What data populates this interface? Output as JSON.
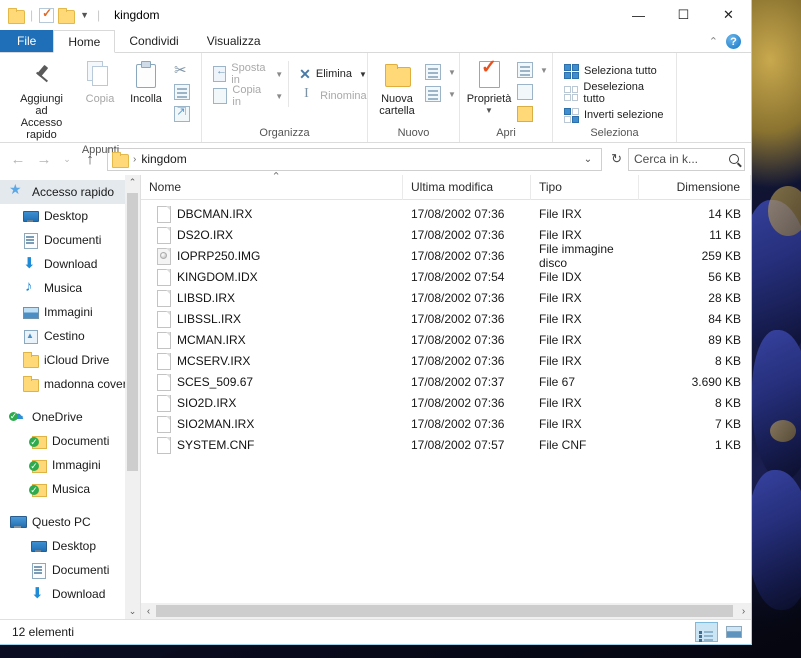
{
  "window": {
    "title": "kingdom",
    "quick_access": [
      "folder-icon",
      "properties-icon",
      "new-folder-icon"
    ],
    "controls": {
      "minimize": "—",
      "maximize": "☐",
      "close": "✕"
    }
  },
  "tabs": [
    {
      "label": "File",
      "kind": "file"
    },
    {
      "label": "Home",
      "kind": "active"
    },
    {
      "label": "Condividi",
      "kind": "normal"
    },
    {
      "label": "Visualizza",
      "kind": "normal"
    }
  ],
  "ribbon": {
    "collapse_caret": "⌃",
    "help": "?",
    "groups": [
      {
        "title": "Appunti",
        "big": [
          {
            "label": "Aggiungi ad\nAccesso rapido",
            "icon": "pin-icon",
            "disabled": false
          },
          {
            "label": "Copia",
            "icon": "copy-icon",
            "disabled": true
          },
          {
            "label": "Incolla",
            "icon": "paste-icon",
            "disabled": false
          }
        ],
        "small": [
          {
            "label": "",
            "icon": "scissors-icon"
          },
          {
            "label": "",
            "icon": "copy-path-icon"
          },
          {
            "label": "",
            "icon": "paste-shortcut-icon"
          }
        ]
      },
      {
        "title": "Organizza",
        "commands": [
          {
            "label": "Sposta in",
            "icon": "move-to-icon",
            "caret": true,
            "disabled": true
          },
          {
            "label": "Copia in",
            "icon": "copy-to-icon",
            "caret": true,
            "disabled": true
          },
          {
            "label": "Elimina",
            "icon": "delete-icon",
            "caret": true,
            "disabled": false
          },
          {
            "label": "Rinomina",
            "icon": "rename-icon",
            "caret": false,
            "disabled": true
          }
        ]
      },
      {
        "title": "Nuovo",
        "big": [
          {
            "label": "Nuova\ncartella",
            "icon": "new-folder-icon"
          }
        ],
        "small": [
          {
            "icon": "new-item-icon",
            "caret": true
          },
          {
            "icon": "easy-access-icon",
            "caret": true
          }
        ]
      },
      {
        "title": "Apri",
        "big": [
          {
            "label": "Proprietà",
            "icon": "properties-icon",
            "caret": true
          }
        ],
        "small": [
          {
            "icon": "open-with-icon",
            "caret": true
          },
          {
            "icon": "edit-icon",
            "caret": false
          },
          {
            "icon": "history-icon",
            "caret": false
          }
        ]
      },
      {
        "title": "Seleziona",
        "commands": [
          {
            "label": "Seleziona tutto",
            "icon": "select-all-icon"
          },
          {
            "label": "Deseleziona tutto",
            "icon": "deselect-all-icon"
          },
          {
            "label": "Inverti selezione",
            "icon": "invert-selection-icon"
          }
        ]
      }
    ]
  },
  "address": {
    "back": "←",
    "forward": "→",
    "recent": "⌄",
    "up": "↑",
    "crumbs": [
      "kingdom"
    ],
    "crumb_sep": "›",
    "dropdown_caret": "⌄",
    "refresh": "↻"
  },
  "search": {
    "placeholder": "Cerca in k...",
    "icon": "search-icon"
  },
  "sidebar": {
    "items": [
      {
        "label": "Accesso rapido",
        "icon": "star-icon",
        "indent": 0,
        "selected": true,
        "pinned": false
      },
      {
        "label": "Desktop",
        "icon": "desktop-icon",
        "indent": 1,
        "selected": false,
        "pinned": true
      },
      {
        "label": "Documenti",
        "icon": "documents-icon",
        "indent": 1,
        "selected": false,
        "pinned": true
      },
      {
        "label": "Download",
        "icon": "download-icon",
        "indent": 1,
        "selected": false,
        "pinned": true
      },
      {
        "label": "Musica",
        "icon": "music-icon",
        "indent": 1,
        "selected": false,
        "pinned": true
      },
      {
        "label": "Immagini",
        "icon": "pictures-icon",
        "indent": 1,
        "selected": false,
        "pinned": true
      },
      {
        "label": "Cestino",
        "icon": "recycle-bin-icon",
        "indent": 1,
        "selected": false,
        "pinned": true
      },
      {
        "label": "iCloud Drive",
        "icon": "folder-icon",
        "indent": 1,
        "selected": false,
        "pinned": true
      },
      {
        "label": "madonna cover",
        "icon": "folder-icon",
        "indent": 1,
        "selected": false,
        "pinned": false
      },
      {
        "label": "",
        "icon": "gap",
        "indent": 0,
        "selected": false,
        "pinned": false
      },
      {
        "label": "OneDrive",
        "icon": "onedrive-icon",
        "indent": 0,
        "selected": false,
        "pinned": false
      },
      {
        "label": "Documenti",
        "icon": "folder-sync-icon",
        "indent": 2,
        "selected": false,
        "pinned": false
      },
      {
        "label": "Immagini",
        "icon": "folder-sync-icon",
        "indent": 2,
        "selected": false,
        "pinned": false
      },
      {
        "label": "Musica",
        "icon": "folder-sync-icon",
        "indent": 2,
        "selected": false,
        "pinned": false
      },
      {
        "label": "",
        "icon": "gap",
        "indent": 0,
        "selected": false,
        "pinned": false
      },
      {
        "label": "Questo PC",
        "icon": "this-pc-icon",
        "indent": 0,
        "selected": false,
        "pinned": false
      },
      {
        "label": "Desktop",
        "icon": "desktop-icon",
        "indent": 2,
        "selected": false,
        "pinned": false
      },
      {
        "label": "Documenti",
        "icon": "documents-icon",
        "indent": 2,
        "selected": false,
        "pinned": false
      },
      {
        "label": "Download",
        "icon": "download-icon",
        "indent": 2,
        "selected": false,
        "pinned": false
      }
    ],
    "scroll_up": "⌃",
    "scroll_down": "⌄"
  },
  "filelist": {
    "columns": [
      {
        "key": "name",
        "label": "Nome",
        "sorted": true
      },
      {
        "key": "mod",
        "label": "Ultima modifica",
        "sorted": false
      },
      {
        "key": "type",
        "label": "Tipo",
        "sorted": false
      },
      {
        "key": "size",
        "label": "Dimensione",
        "sorted": false
      }
    ],
    "rows": [
      {
        "name": "DBCMAN.IRX",
        "mod": "17/08/2002 07:36",
        "type": "File IRX",
        "size": "14 KB",
        "icon": "file-icon"
      },
      {
        "name": "DS2O.IRX",
        "mod": "17/08/2002 07:36",
        "type": "File IRX",
        "size": "11 KB",
        "icon": "file-icon"
      },
      {
        "name": "IOPRP250.IMG",
        "mod": "17/08/2002 07:36",
        "type": "File immagine disco",
        "size": "259 KB",
        "icon": "disc-image-icon"
      },
      {
        "name": "KINGDOM.IDX",
        "mod": "17/08/2002 07:54",
        "type": "File IDX",
        "size": "56 KB",
        "icon": "file-icon"
      },
      {
        "name": "LIBSD.IRX",
        "mod": "17/08/2002 07:36",
        "type": "File IRX",
        "size": "28 KB",
        "icon": "file-icon"
      },
      {
        "name": "LIBSSL.IRX",
        "mod": "17/08/2002 07:36",
        "type": "File IRX",
        "size": "84 KB",
        "icon": "file-icon"
      },
      {
        "name": "MCMAN.IRX",
        "mod": "17/08/2002 07:36",
        "type": "File IRX",
        "size": "89 KB",
        "icon": "file-icon"
      },
      {
        "name": "MCSERV.IRX",
        "mod": "17/08/2002 07:36",
        "type": "File IRX",
        "size": "8 KB",
        "icon": "file-icon"
      },
      {
        "name": "SCES_509.67",
        "mod": "17/08/2002 07:37",
        "type": "File 67",
        "size": "3.690 KB",
        "icon": "file-icon"
      },
      {
        "name": "SIO2D.IRX",
        "mod": "17/08/2002 07:36",
        "type": "File IRX",
        "size": "8 KB",
        "icon": "file-icon"
      },
      {
        "name": "SIO2MAN.IRX",
        "mod": "17/08/2002 07:36",
        "type": "File IRX",
        "size": "7 KB",
        "icon": "file-icon"
      },
      {
        "name": "SYSTEM.CNF",
        "mod": "17/08/2002 07:57",
        "type": "File CNF",
        "size": "1 KB",
        "icon": "file-icon"
      }
    ],
    "hscroll_left": "‹",
    "hscroll_right": "›"
  },
  "statusbar": {
    "item_count": "12 elementi",
    "views": [
      {
        "name": "details-view",
        "active": true
      },
      {
        "name": "large-icons-view",
        "active": false
      }
    ]
  }
}
